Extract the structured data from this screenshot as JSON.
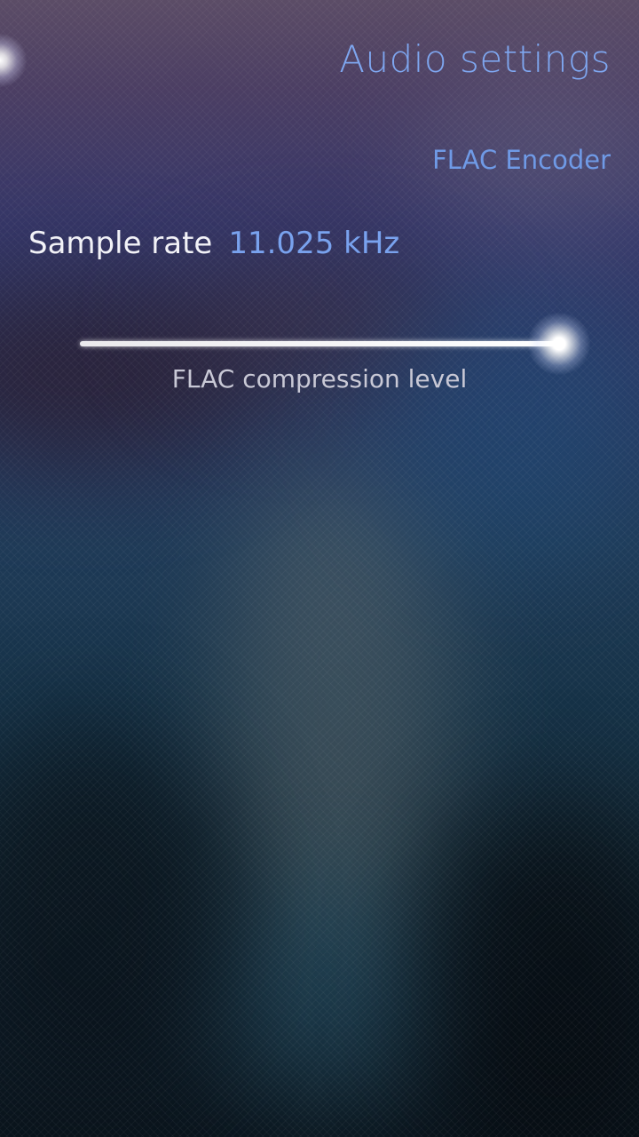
{
  "page": {
    "title": "Audio settings"
  },
  "section": {
    "header": "FLAC Encoder"
  },
  "sample_rate": {
    "label": "Sample rate",
    "value": "11.025 kHz"
  },
  "compression_slider": {
    "label": "FLAC compression level",
    "level_fraction": 1.0
  },
  "colors": {
    "highlight": "#7ea6ef",
    "primary_text": "#f2f2f7",
    "secondary_text": "#c9c9d6"
  }
}
